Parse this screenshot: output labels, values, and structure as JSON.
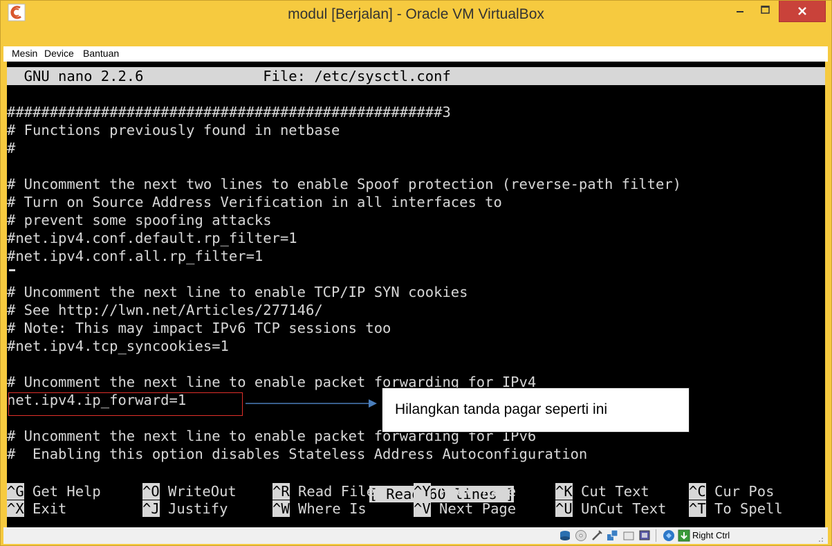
{
  "window": {
    "title": "modul [Berjalan] - Oracle VM VirtualBox",
    "minimize_glyph": "−",
    "maximize_glyph": "□",
    "close_glyph": "×"
  },
  "menubar": {
    "items": [
      "Mesin",
      "Device",
      "Bantuan"
    ]
  },
  "nano": {
    "header": "  GNU nano 2.2.6              File: /etc/sysctl.conf",
    "lines": [
      "",
      "###################################################3",
      "# Functions previously found in netbase",
      "#",
      "",
      "# Uncomment the next two lines to enable Spoof protection (reverse-path filter)",
      "# Turn on Source Address Verification in all interfaces to",
      "# prevent some spoofing attacks",
      "#net.ipv4.conf.default.rp_filter=1",
      "#net.ipv4.conf.all.rp_filter=1",
      "",
      "# Uncomment the next line to enable TCP/IP SYN cookies",
      "# See http://lwn.net/Articles/277146/",
      "# Note: This may impact IPv6 TCP sessions too",
      "#net.ipv4.tcp_syncookies=1",
      "",
      "# Uncomment the next line to enable packet forwarding for IPv4",
      "net.ipv4.ip_forward=1",
      "",
      "# Uncomment the next line to enable packet forwarding for IPv6",
      "#  Enabling this option disables Stateless Address Autoconfiguration"
    ],
    "status_message": "[ Read 60 lines ]",
    "shortcuts_row1": [
      {
        "key": "^G",
        "label": "Get Help"
      },
      {
        "key": "^O",
        "label": "WriteOut"
      },
      {
        "key": "^R",
        "label": "Read File"
      },
      {
        "key": "^Y",
        "label": "Prev Page"
      },
      {
        "key": "^K",
        "label": "Cut Text"
      },
      {
        "key": "^C",
        "label": "Cur Pos"
      }
    ],
    "shortcuts_row2": [
      {
        "key": "^X",
        "label": "Exit"
      },
      {
        "key": "^J",
        "label": "Justify"
      },
      {
        "key": "^W",
        "label": "Where Is"
      },
      {
        "key": "^V",
        "label": "Next Page"
      },
      {
        "key": "^U",
        "label": "UnCut Text"
      },
      {
        "key": "^T",
        "label": "To Spell"
      }
    ]
  },
  "annotation": {
    "callout_text": "Hilangkan tanda pagar seperti ini"
  },
  "statusbar": {
    "icons": [
      "hard-disk-icon",
      "optical-drive-icon",
      "usb-icon",
      "network-icon",
      "shared-folder-icon",
      "display-icon",
      "mouse-integration-icon",
      "keyboard-capture-icon"
    ],
    "host_key": "Right Ctrl"
  },
  "colors": {
    "frame": "#f6ca3f",
    "terminal_bg": "#000000",
    "terminal_fg": "#d7d7d7",
    "close_button": "#c9423a",
    "annotation_red": "#e0302a",
    "arrow_blue": "#4a7ebb"
  }
}
